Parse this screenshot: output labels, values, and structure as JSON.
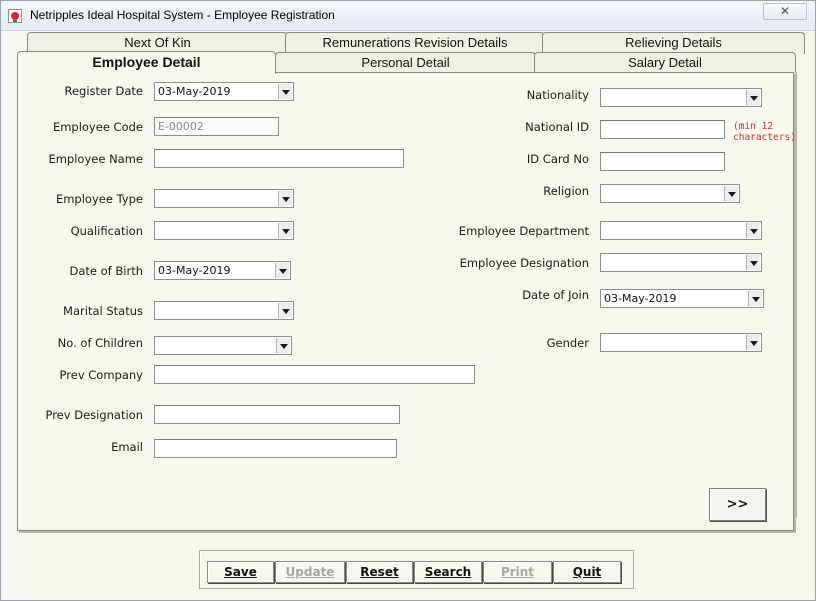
{
  "window": {
    "title": "Netripples Ideal Hospital System - Employee Registration",
    "close_glyph": "✕"
  },
  "tabs": {
    "row_top": [
      "Next Of Kin",
      "Remunerations Revision Details",
      "Relieving Details"
    ],
    "row_bottom": [
      "Employee Detail",
      "Personal Detail",
      "Salary Detail"
    ],
    "active": "Employee Detail"
  },
  "form": {
    "register_date": {
      "label": "Register Date",
      "value": "03-May-2019"
    },
    "employee_code": {
      "label": "Employee Code",
      "value": "E-00002"
    },
    "employee_name": {
      "label": "Employee Name",
      "value": ""
    },
    "employee_type": {
      "label": "Employee Type",
      "value": ""
    },
    "qualification": {
      "label": "Qualification",
      "value": ""
    },
    "date_of_birth": {
      "label": "Date of Birth",
      "value": "03-May-2019"
    },
    "marital_status": {
      "label": "Marital Status",
      "value": ""
    },
    "children": {
      "label": "No. of Children",
      "value": ""
    },
    "prev_company": {
      "label": "Prev Company",
      "value": ""
    },
    "prev_designation": {
      "label": "Prev Designation",
      "value": ""
    },
    "email": {
      "label": "Email",
      "value": ""
    },
    "nationality": {
      "label": "Nationality",
      "value": ""
    },
    "national_id": {
      "label": "National ID",
      "value": "",
      "hint": "(min 12 characters)"
    },
    "id_card_no": {
      "label": "ID Card No",
      "value": ""
    },
    "religion": {
      "label": "Religion",
      "value": ""
    },
    "department": {
      "label": "Employee Department",
      "value": ""
    },
    "designation": {
      "label": "Employee Designation",
      "value": ""
    },
    "date_of_join": {
      "label": "Date of Join",
      "value": "03-May-2019"
    },
    "gender": {
      "label": "Gender",
      "value": ""
    }
  },
  "next_button": ">>",
  "actions": {
    "save": "Save",
    "update": "Update",
    "reset": "Reset",
    "search": "Search",
    "print": "Print",
    "quit": "Quit"
  },
  "colors": {
    "panel_bg": "#f7f7ee",
    "hint_text": "#c0392b",
    "disabled_text": "#a6a6a6"
  }
}
